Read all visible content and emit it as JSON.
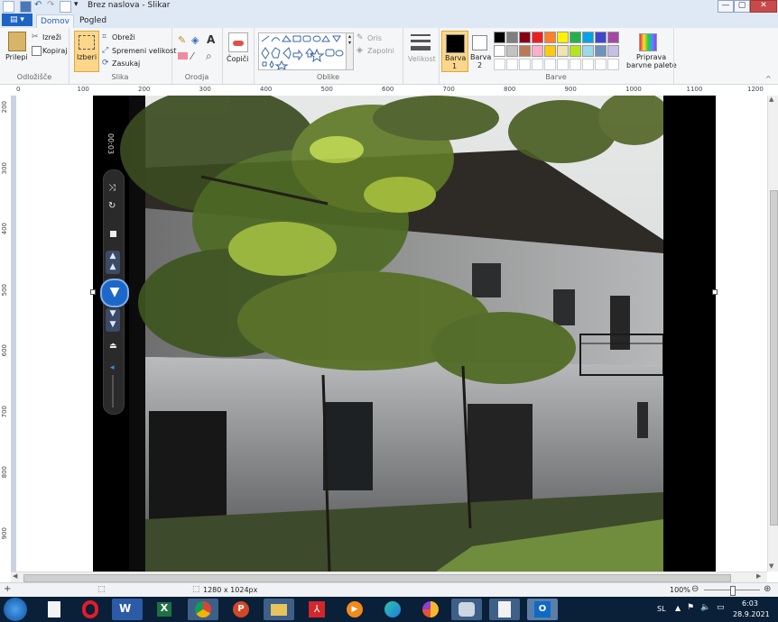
{
  "window": {
    "title": "Brez naslova - Slikar",
    "minimize": "—",
    "maximize": "▢",
    "close": "✕"
  },
  "tabs": {
    "file": "▤ ▾",
    "home": "Domov",
    "view": "Pogled"
  },
  "ribbon": {
    "clipboard": {
      "paste": "Prilepi",
      "cut": "Izreži",
      "copy": "Kopiraj",
      "group": "Odložišče"
    },
    "image": {
      "select": "Izberi",
      "crop": "Obreži",
      "resize": "Spremeni velikost",
      "rotate": "Zasukaj",
      "group": "Slika"
    },
    "tools": {
      "group": "Orodja"
    },
    "brushes": {
      "label": "Čopiči"
    },
    "shapes": {
      "outline": "Oris",
      "fill": "Zapolni",
      "group": "Oblike"
    },
    "size": {
      "label": "Velikost"
    },
    "colors": {
      "color1": "Barva",
      "color1_num": "1",
      "color2": "Barva",
      "color2_num": "2",
      "edit": "Priprava",
      "edit2": "barvne palete",
      "group": "Barve",
      "palette_row1": [
        "#000000",
        "#7f7f7f",
        "#880015",
        "#ed1c24",
        "#ff7f27",
        "#fff200",
        "#22b14c",
        "#00a2e8",
        "#3f48cc",
        "#a349a4"
      ],
      "palette_row2": [
        "#ffffff",
        "#c3c3c3",
        "#b97a57",
        "#ffaec9",
        "#ffc90e",
        "#efe4b0",
        "#b5e61d",
        "#99d9ea",
        "#7092be",
        "#c8bfe7"
      ]
    }
  },
  "ruler": {
    "h": [
      "0",
      "100",
      "200",
      "300",
      "400",
      "500",
      "600",
      "700",
      "800",
      "900",
      "1000",
      "1100",
      "1200"
    ],
    "v": [
      "200",
      "300",
      "400",
      "500",
      "600",
      "700",
      "800",
      "900"
    ]
  },
  "video": {
    "time": "00:03"
  },
  "status": {
    "image_size": "1280 x 1024px",
    "zoom": "100%"
  },
  "taskbar": {
    "lang": "SL",
    "time": "6:03",
    "date": "28.9.2021"
  }
}
